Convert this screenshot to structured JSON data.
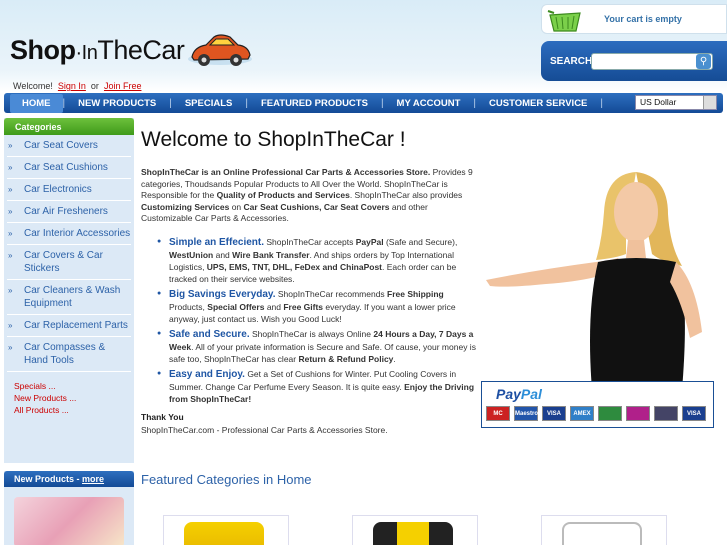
{
  "header": {
    "logo_part1": "Shop",
    "logo_part2": "·In",
    "logo_part3": "The",
    "logo_part4": "Car",
    "welcome_prefix": "Welcome!",
    "sign_in": "Sign In",
    "or": "or",
    "join_free": "Join Free"
  },
  "cart": {
    "text": "Your cart is empty"
  },
  "search": {
    "label": "SEARCH",
    "value": "",
    "placeholder": ""
  },
  "nav": {
    "items": [
      "HOME",
      "NEW PRODUCTS",
      "SPECIALS",
      "FEATURED PRODUCTS",
      "MY ACCOUNT",
      "CUSTOMER SERVICE"
    ],
    "separator": "|",
    "currency": "US Dollar"
  },
  "sidebar": {
    "title": "Categories",
    "arrow": "»",
    "categories": [
      "Car Seat Covers",
      "Car Seat Cushions",
      "Car Electronics",
      "Car Air Fresheners",
      "Car Interior Accessories",
      "Car Covers & Car Stickers",
      "Car Cleaners & Wash Equipment",
      "Car Replacement Parts",
      "Car Compasses & Hand Tools"
    ],
    "links": [
      "Specials ...",
      "New Products ...",
      "All Products ..."
    ]
  },
  "new_products": {
    "title": "New Products - ",
    "more": "more"
  },
  "main": {
    "title": "Welcome to ShopInTheCar !",
    "intro": [
      {
        "b": "ShopInTheCar is an Online Professional Car Parts & Accessories Store."
      },
      {
        "t": " Provides 9 categories, Thoudsands Popular Products to All Over the World. ShopInTheCar is Responsible for the "
      },
      {
        "b": "Quality of Products and Services"
      },
      {
        "t": ". ShopInTheCar also provides "
      },
      {
        "b": "Customizing Services"
      },
      {
        "t": " on "
      },
      {
        "b": "Car Seat Cushions, Car Seat Covers"
      },
      {
        "t": " and other Customizable Car Parts & Accessories."
      }
    ],
    "bullets": [
      {
        "heading": "Simple an Effecient.",
        "parts": [
          {
            "t": " ShopInTheCar accepts "
          },
          {
            "b": "PayPal"
          },
          {
            "t": " (Safe and Secure), "
          },
          {
            "b": "WestUnion"
          },
          {
            "t": " and "
          },
          {
            "b": "Wire Bank Transfer"
          },
          {
            "t": ". And ships orders by Top International Logistics, "
          },
          {
            "b": "UPS, EMS, TNT, DHL, FeDex and ChinaPost"
          },
          {
            "t": ". Each order can be tracked on their service websites."
          }
        ]
      },
      {
        "heading": "Big Savings Everyday.",
        "parts": [
          {
            "t": " ShopInTheCar recommends "
          },
          {
            "b": "Free Shipping"
          },
          {
            "t": " Products, "
          },
          {
            "b": "Special Offers"
          },
          {
            "t": " and "
          },
          {
            "b": "Free Gifts"
          },
          {
            "t": " everyday. If you want a lower price anyway, just contact us. Wish you Good Luck!"
          }
        ]
      },
      {
        "heading": "Safe and Secure.",
        "parts": [
          {
            "t": " ShopInTheCar is always Online "
          },
          {
            "b": "24 Hours a Day, 7 Days a Week"
          },
          {
            "t": ". All of your private information is Secure and Safe. Of cause, your money is safe too, ShopInTheCar has clear "
          },
          {
            "b": "Return & Refund Policy"
          },
          {
            "t": "."
          }
        ]
      },
      {
        "heading": "Easy and Enjoy.",
        "parts": [
          {
            "t": " Get a Set of Cushions for Winter. Put Cooling Covers in Summer. Change Car Perfume Every Season. It is quite easy. "
          },
          {
            "b": "Enjoy the Driving from ShopInTheCar!"
          }
        ]
      }
    ],
    "thanks": "Thank You",
    "signature": "ShopInTheCar.com - Professional Car Parts & Accessories Store.",
    "featured_title": "Featured Categories in Home"
  },
  "paypal": {
    "logo_pay": "Pay",
    "logo_pal": "Pal",
    "cards": [
      {
        "label": "MC",
        "color": "#cc2222"
      },
      {
        "label": "Maestro",
        "color": "#2255aa"
      },
      {
        "label": "VISA",
        "color": "#1a3f8f"
      },
      {
        "label": "AMEX",
        "color": "#2f7fc8"
      },
      {
        "label": "",
        "color": "#2e8b3e"
      },
      {
        "label": "",
        "color": "#b0208a"
      },
      {
        "label": "",
        "color": "#444466"
      },
      {
        "label": "VISA",
        "color": "#1a3f8f"
      }
    ]
  },
  "colors": {
    "accent_blue": "#1f56a4",
    "nav_blue": "#134a96",
    "category_green": "#3f9a1a",
    "link_red": "#cc0000"
  }
}
